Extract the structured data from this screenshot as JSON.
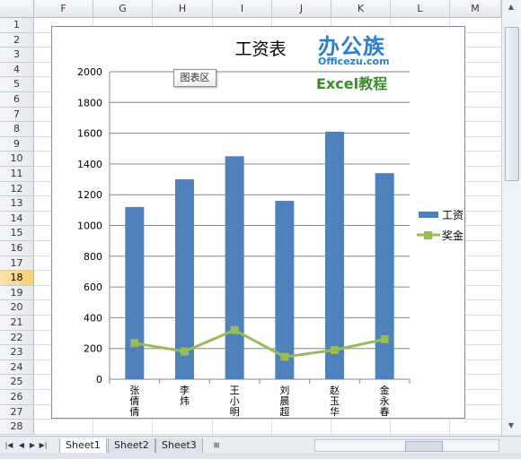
{
  "spreadsheet": {
    "columns": [
      "F",
      "G",
      "H",
      "I",
      "J",
      "K",
      "L",
      "M"
    ],
    "rows": [
      "1",
      "2",
      "3",
      "4",
      "5",
      "6",
      "7",
      "8",
      "9",
      "10",
      "11",
      "12",
      "13",
      "14",
      "15",
      "16",
      "17",
      "18",
      "19",
      "20",
      "21",
      "22",
      "23",
      "24",
      "25",
      "26",
      "27",
      "28"
    ],
    "selected_row": "18",
    "tabs": [
      "Sheet1",
      "Sheet2",
      "Sheet3"
    ],
    "active_tab": "Sheet1",
    "tooltip": "图表区"
  },
  "logo": {
    "main": "办公族",
    "url": "Officezu.com",
    "tag": "Excel教程"
  },
  "colors": {
    "bar": "#4f81bd",
    "line": "#9bbb59",
    "gridline": "#878787"
  },
  "chart_data": {
    "type": "bar",
    "title": "工资表",
    "categories": [
      "张倩倩",
      "李炜",
      "王小明",
      "刘晨超",
      "赵玉华",
      "金永春"
    ],
    "ylim": [
      0,
      2000
    ],
    "yticks": [
      0,
      200,
      400,
      600,
      800,
      1000,
      1200,
      1400,
      1600,
      1800,
      2000
    ],
    "series": [
      {
        "name": "工资",
        "type": "bar",
        "values": [
          1120,
          1300,
          1450,
          1160,
          1610,
          1340
        ]
      },
      {
        "name": "奖金",
        "type": "line",
        "values": [
          235,
          180,
          320,
          145,
          190,
          260
        ]
      }
    ],
    "legend_position": "right",
    "grid": true
  }
}
